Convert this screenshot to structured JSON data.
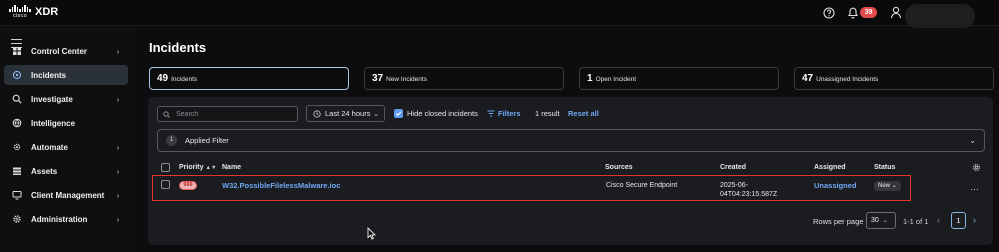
{
  "app": {
    "logo_text": "cisco",
    "title": "XDR"
  },
  "header": {
    "notification_count": "39"
  },
  "sidebar": {
    "items": [
      {
        "label": "Control Center",
        "icon": "dashboard-icon",
        "has_chevron": true,
        "active": false
      },
      {
        "label": "Incidents",
        "icon": "incidents-icon",
        "has_chevron": false,
        "active": true
      },
      {
        "label": "Investigate",
        "icon": "investigate-icon",
        "has_chevron": true,
        "active": false
      },
      {
        "label": "Intelligence",
        "icon": "intelligence-icon",
        "has_chevron": false,
        "active": false
      },
      {
        "label": "Automate",
        "icon": "automate-icon",
        "has_chevron": true,
        "active": false
      },
      {
        "label": "Assets",
        "icon": "assets-icon",
        "has_chevron": true,
        "active": false
      },
      {
        "label": "Client Management",
        "icon": "client-management-icon",
        "has_chevron": true,
        "active": false
      },
      {
        "label": "Administration",
        "icon": "administration-icon",
        "has_chevron": true,
        "active": false
      }
    ]
  },
  "page": {
    "title": "Incidents"
  },
  "stats": [
    {
      "value": "49",
      "label": "Incidents",
      "active": true
    },
    {
      "value": "37",
      "label": "New Incidents",
      "active": false
    },
    {
      "value": "1",
      "label": "Open Incident",
      "active": false
    },
    {
      "value": "47",
      "label": "Unassigned Incidents",
      "active": false
    }
  ],
  "toolbar": {
    "search_placeholder": "Search",
    "time_range": "Last 24 hours",
    "hide_closed_label": "Hide closed incidents",
    "hide_closed_checked": true,
    "filters_label": "Filters",
    "result_count": "1 result",
    "reset_label": "Reset all"
  },
  "applied_filter": {
    "count": "1",
    "label": "Applied Filter"
  },
  "table": {
    "columns": [
      "Priority",
      "Name",
      "Sources",
      "Created",
      "Assigned",
      "Status"
    ],
    "rows": [
      {
        "priority": "960",
        "name": "W32.PossibleFilelessMalware.ioc",
        "source": "Cisco Secure Endpoint",
        "created_line1": "2025-06-",
        "created_line2": "04T04:23:15.587Z",
        "assigned": "Unassigned",
        "status": "New"
      }
    ]
  },
  "pagination": {
    "rows_per_page_label": "Rows per page",
    "rows_per_page": "30",
    "range": "1-1 of 1",
    "page": "1"
  },
  "colors": {
    "accent": "#6fa8f5",
    "highlight_border": "#e0362a",
    "priority_badge": "#f0b6b6",
    "notification": "#e24b4b"
  }
}
